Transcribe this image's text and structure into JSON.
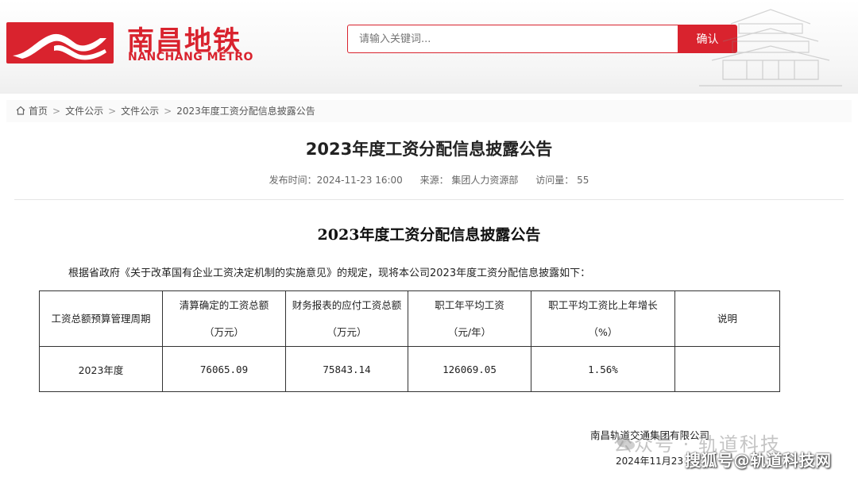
{
  "brand": {
    "name_cn": "南昌地铁",
    "name_en": "NANCHANG METRO",
    "accent": "#d9232e"
  },
  "search": {
    "placeholder": "请输入关键词...",
    "button_label": "确认"
  },
  "breadcrumb": {
    "home": "首页",
    "items": [
      "文件公示",
      "文件公示",
      "2023年度工资分配信息披露公告"
    ],
    "separator": ">"
  },
  "article": {
    "title": "2023年度工资分配信息披露公告",
    "publish_label": "发布时间：2024-11-23 16:00",
    "source_label": "来源： 集团人力资源部",
    "views_label": "访问量： 55",
    "subtitle": "2023年度工资分配信息披露公告",
    "intro": "根据省政府《关于改革国有企业工资决定机制的实施意见》的规定，现将本公司2023年度工资分配信息披露如下：",
    "table": {
      "headers": [
        [
          "工资总额预算管理周期"
        ],
        [
          "清算确定的工资总额",
          "（万元）"
        ],
        [
          "财务报表的应付工资总额",
          "（万元）"
        ],
        [
          "职工年平均工资",
          "（元/年）"
        ],
        [
          "职工平均工资比上年增长",
          "（%）"
        ],
        [
          "说明"
        ]
      ],
      "rows": [
        [
          "2023年度",
          "76065.09",
          "75843.14",
          "126069.05",
          "1.56%",
          ""
        ]
      ]
    },
    "signature_company": "南昌轨道交通集团有限公司",
    "signature_date": "2024年11月23"
  },
  "watermark": {
    "text1": "公众号 · 轨道科技",
    "text2": "搜狐号@轨道科技网"
  }
}
